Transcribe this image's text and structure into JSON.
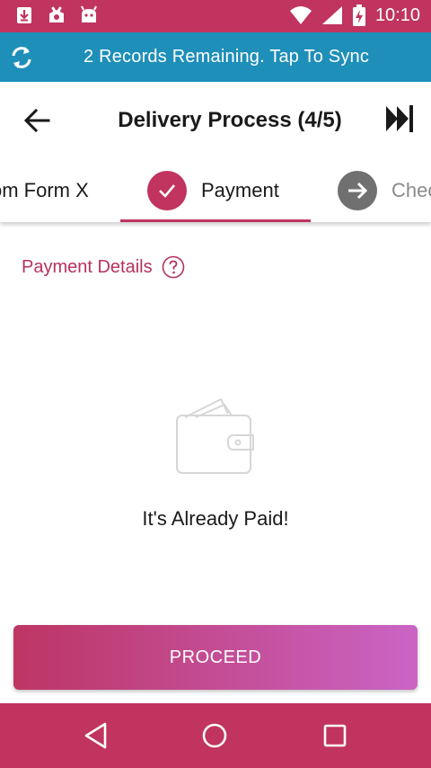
{
  "status_bar": {
    "time": "10:10",
    "left_icons": [
      "download-icon",
      "android-icon",
      "robot-icon"
    ],
    "right_icons": [
      "wifi-icon",
      "signal-icon",
      "battery-charging-icon"
    ]
  },
  "sync_bar": {
    "icon": "sync-icon",
    "text": "2 Records Remaining. Tap To Sync"
  },
  "toolbar": {
    "title": "Delivery Process (4/5)",
    "back_icon": "arrow-left-icon",
    "skip_icon": "skip-forward-icon"
  },
  "tabs": [
    {
      "label": "om Form X",
      "state": "previous"
    },
    {
      "label": "Payment",
      "state": "current",
      "icon": "check-icon"
    },
    {
      "label": "Chec",
      "state": "next",
      "icon": "arrow-right-icon"
    }
  ],
  "section": {
    "title": "Payment Details",
    "help_icon": "help-icon"
  },
  "content": {
    "icon": "wallet-icon",
    "message": "It's Already Paid!"
  },
  "actions": {
    "proceed_label": "PROCEED"
  },
  "nav_bar": {
    "icons": [
      "back-triangle-icon",
      "home-circle-icon",
      "recents-square-icon"
    ]
  },
  "colors": {
    "primary": "#c0345f",
    "sync_bar": "#1e8fb9",
    "button_gradient_start": "#bd3563",
    "button_gradient_end": "#ca64c5",
    "inactive_step": "#707070"
  }
}
